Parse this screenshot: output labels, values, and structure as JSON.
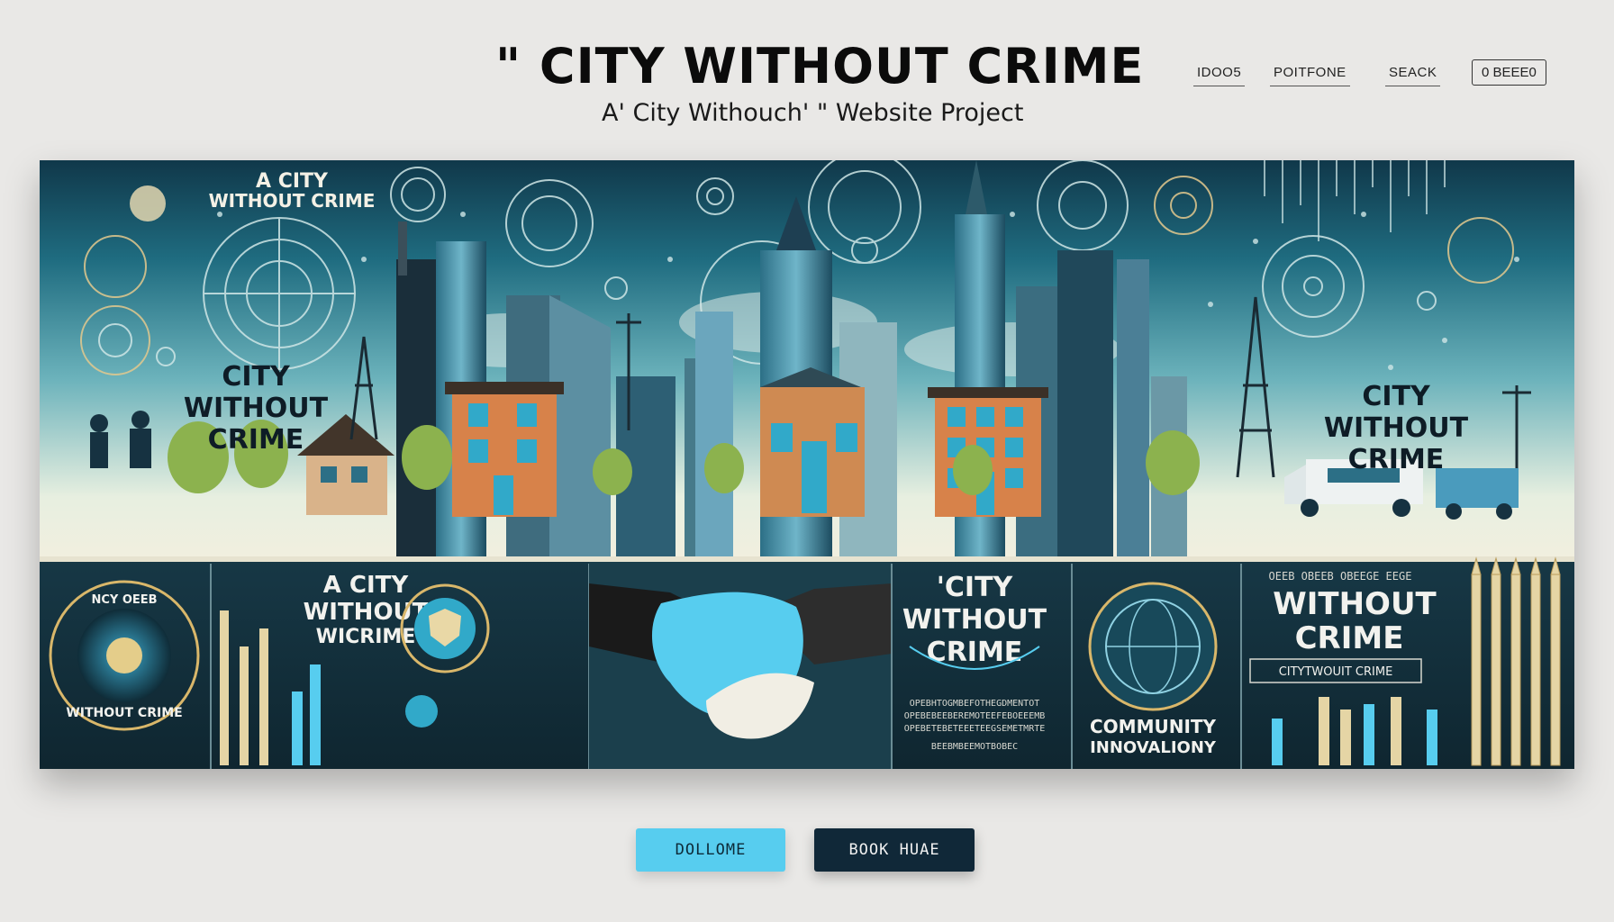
{
  "header": {
    "title": "\" CITY WITHOUT CRIME",
    "subtitle": "A' City Withouch' \" Website Project"
  },
  "nav": {
    "items": [
      "IDOO5",
      "POITFONE",
      "SEACK"
    ],
    "button_label": "0  BEEE0"
  },
  "banner": {
    "top_left_heading": [
      "A CITY",
      "WITHOUT CRIME"
    ],
    "left_heading": [
      "CITY",
      "WITHOUT",
      "CRIME"
    ],
    "right_heading": [
      "CITY",
      "WITHOUT",
      "CRIME"
    ],
    "panel1_ring_top": "NCY  OEEB",
    "panel1_ring_bottom": "WITHOUT CRIME",
    "panel2_heading": [
      "A CITY",
      "WITHOUT",
      "WICRIME"
    ],
    "panel4_heading": [
      "'CITY",
      "WITHOUT",
      "CRIME"
    ],
    "panel4_small": [
      "OPEBHTOGMBEFOTHEGDMENTOT",
      "OPEBEBEEBEREMOTEEFEBOEEEMB",
      "OPEBETEBETEEETEEGSEMETMRTE",
      "BEEBMBEEMOTBOBEC"
    ],
    "panel5_label": [
      "COMMUNITY",
      "INNOVALIONY"
    ],
    "panel6_top": "OEEB  OBEEB  OBEEGE  EEGE",
    "panel6_heading": [
      "WITHOUT",
      "CRIME"
    ],
    "panel6_box": "CITYTWOUIT CRIME"
  },
  "cta": {
    "primary": "DOLLOME",
    "secondary": "BOOK HUAE"
  },
  "colors": {
    "accent": "#57cdef",
    "dark": "#102838",
    "page_background": "#e9e8e6"
  }
}
